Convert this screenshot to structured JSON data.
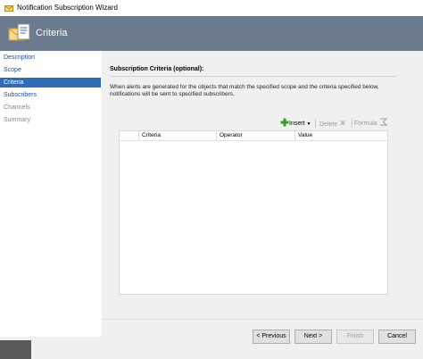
{
  "window": {
    "title": "Notification Subscription Wizard"
  },
  "header": {
    "title": "Criteria"
  },
  "nav": {
    "items": [
      {
        "label": "Description",
        "state": "link"
      },
      {
        "label": "Scope",
        "state": "link"
      },
      {
        "label": "Criteria",
        "state": "selected"
      },
      {
        "label": "Subscribers",
        "state": "link"
      },
      {
        "label": "Channels",
        "state": "disabled"
      },
      {
        "label": "Summary",
        "state": "disabled"
      }
    ]
  },
  "main": {
    "section_title": "Subscription Criteria (optional):",
    "description": "When alerts are generated for the objects that match the specified scope and the criteria specified below, notifications will be sent to specified subscribers."
  },
  "toolbar": {
    "insert_label": "Insert",
    "delete_label": "Delete",
    "formula_label": "Formula"
  },
  "grid": {
    "columns": [
      "",
      "Criteria",
      "Operator",
      "Value"
    ],
    "rows": []
  },
  "footer": {
    "previous_label": "< Previous",
    "next_label": "Next >",
    "finish_label": "Finish",
    "cancel_label": "Cancel"
  },
  "colors": {
    "header_bg": "#6b7a8c",
    "nav_selected_bg": "#2f6cb5",
    "nav_link": "#1f4e8c",
    "nav_disabled": "#888888",
    "insert_icon": "#3c9a2c"
  }
}
